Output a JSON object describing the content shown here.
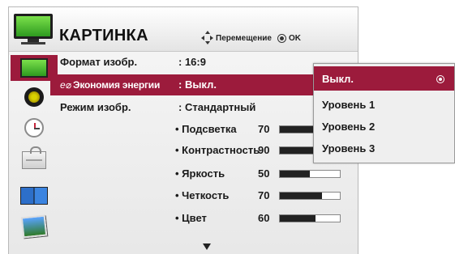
{
  "header": {
    "title": "КАРТИНКА",
    "nav_hint": "Перемещение",
    "ok_hint": "OK",
    "icon": "tv-icon"
  },
  "sidebar": {
    "items": [
      {
        "icon": "picture-tv-icon",
        "active": true
      },
      {
        "icon": "audio-speaker-icon",
        "active": false
      },
      {
        "icon": "time-clock-icon",
        "active": false
      },
      {
        "icon": "lock-icon",
        "active": false
      },
      {
        "icon": "option-screens-icon",
        "active": false
      },
      {
        "icon": "photo-icon",
        "active": false
      }
    ]
  },
  "menu": {
    "rows": [
      {
        "label": "Формат изобр.",
        "value": ": 16:9"
      },
      {
        "label": "Экономия энергии",
        "value": ": Выкл.",
        "highlighted": true
      },
      {
        "label": "Режим изобр.",
        "value": ": Стандартный"
      }
    ],
    "sub_settings": [
      {
        "label": "• Подсветка",
        "value": "70",
        "level": 70
      },
      {
        "label": "• Контрастность",
        "value": "90",
        "level": 90
      },
      {
        "label": "• Яркость",
        "value": "50",
        "level": 50
      },
      {
        "label": "• Четкость",
        "value": "70",
        "level": 70
      },
      {
        "label": "• Цвет",
        "value": "60",
        "level": 60
      }
    ]
  },
  "popup": {
    "options": [
      {
        "label": "Выкл.",
        "selected": true
      },
      {
        "label": "Уровень 1",
        "selected": false
      },
      {
        "label": "Уровень 2",
        "selected": false
      },
      {
        "label": "Уровень 3",
        "selected": false
      }
    ]
  },
  "colors": {
    "accent": "#9c1b3c",
    "panel": "#eeeeee",
    "text": "#1a1a1a"
  }
}
